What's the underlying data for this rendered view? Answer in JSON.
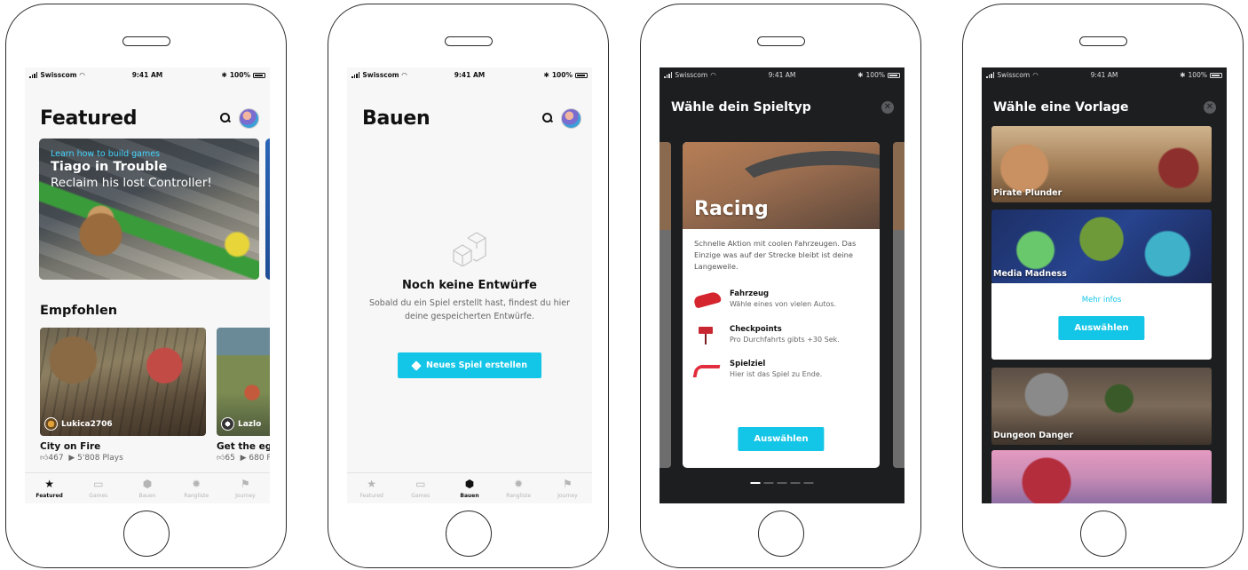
{
  "status_bar": {
    "carrier": "Swisscom",
    "time": "9:41 AM",
    "battery": "100%"
  },
  "tabs": [
    {
      "label": "Featured",
      "icon": "star-icon"
    },
    {
      "label": "Games",
      "icon": "gamepad-icon"
    },
    {
      "label": "Bauen",
      "icon": "cube-icon"
    },
    {
      "label": "Rangliste",
      "icon": "badge-icon"
    },
    {
      "label": "Journey",
      "icon": "flag-icon"
    }
  ],
  "screen1": {
    "title": "Featured",
    "hero": {
      "kicker": "Learn how to build games",
      "title": "Tiago in Trouble",
      "subtitle": "Reclaim his lost Controller!"
    },
    "section_title": "Empfohlen",
    "recommended": [
      {
        "creator": "Lukica2706",
        "title": "City on Fire",
        "likes": "467",
        "plays": "5'808 Plays"
      },
      {
        "creator": "Lazlo",
        "title": "Get the egg",
        "likes": "65",
        "plays": "680 P"
      }
    ]
  },
  "screen2": {
    "title": "Bauen",
    "empty_title": "Noch keine Entwürfe",
    "empty_text": "Sobald du ein Spiel erstellt hast, findest du hier deine gespeicherten Entwürfe.",
    "cta_label": "Neues Spiel erstellen"
  },
  "screen3": {
    "title": "Wähle dein Spieltyp",
    "card": {
      "name": "Racing",
      "description": "Schnelle Aktion mit coolen Fahrzeugen. Das Einzige was auf der Strecke bleibt  ist deine Langeweile.",
      "features": [
        {
          "name": "Fahrzeug",
          "text": "Wähle eines von vielen Autos."
        },
        {
          "name": "Checkpoints",
          "text": "Pro Durchfahrts gibts +30 Sek."
        },
        {
          "name": "Spielziel",
          "text": "Hier ist das Spiel zu Ende."
        }
      ],
      "button_label": "Auswählen"
    },
    "pager": {
      "count": 5,
      "active": 1
    }
  },
  "screen4": {
    "title": "Wähle eine Vorlage",
    "templates": [
      "Pirate Plunder",
      "Media Madness",
      "Dungeon Danger"
    ],
    "more_info": "Mehr infos",
    "button_label": "Auswählen"
  },
  "colors": {
    "accent": "#13c5e6",
    "hero_kicker": "#43d3ff",
    "dark_bg": "#1d1e20"
  }
}
